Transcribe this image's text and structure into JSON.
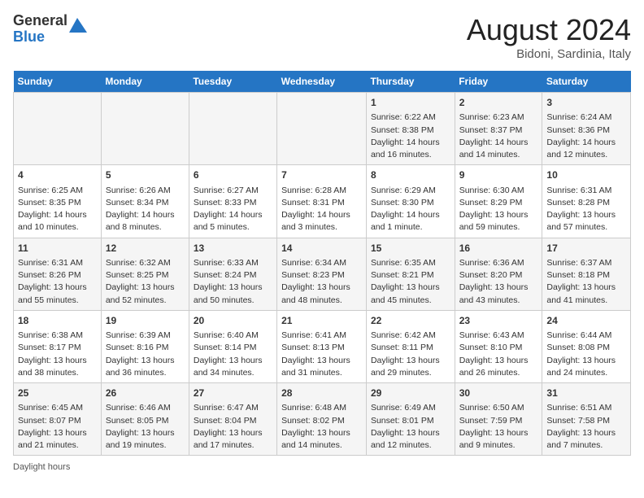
{
  "header": {
    "logo_general": "General",
    "logo_blue": "Blue",
    "month_year": "August 2024",
    "location": "Bidoni, Sardinia, Italy"
  },
  "days_of_week": [
    "Sunday",
    "Monday",
    "Tuesday",
    "Wednesday",
    "Thursday",
    "Friday",
    "Saturday"
  ],
  "weeks": [
    [
      {
        "day": "",
        "info": ""
      },
      {
        "day": "",
        "info": ""
      },
      {
        "day": "",
        "info": ""
      },
      {
        "day": "",
        "info": ""
      },
      {
        "day": "1",
        "info": "Sunrise: 6:22 AM\nSunset: 8:38 PM\nDaylight: 14 hours and 16 minutes."
      },
      {
        "day": "2",
        "info": "Sunrise: 6:23 AM\nSunset: 8:37 PM\nDaylight: 14 hours and 14 minutes."
      },
      {
        "day": "3",
        "info": "Sunrise: 6:24 AM\nSunset: 8:36 PM\nDaylight: 14 hours and 12 minutes."
      }
    ],
    [
      {
        "day": "4",
        "info": "Sunrise: 6:25 AM\nSunset: 8:35 PM\nDaylight: 14 hours and 10 minutes."
      },
      {
        "day": "5",
        "info": "Sunrise: 6:26 AM\nSunset: 8:34 PM\nDaylight: 14 hours and 8 minutes."
      },
      {
        "day": "6",
        "info": "Sunrise: 6:27 AM\nSunset: 8:33 PM\nDaylight: 14 hours and 5 minutes."
      },
      {
        "day": "7",
        "info": "Sunrise: 6:28 AM\nSunset: 8:31 PM\nDaylight: 14 hours and 3 minutes."
      },
      {
        "day": "8",
        "info": "Sunrise: 6:29 AM\nSunset: 8:30 PM\nDaylight: 14 hours and 1 minute."
      },
      {
        "day": "9",
        "info": "Sunrise: 6:30 AM\nSunset: 8:29 PM\nDaylight: 13 hours and 59 minutes."
      },
      {
        "day": "10",
        "info": "Sunrise: 6:31 AM\nSunset: 8:28 PM\nDaylight: 13 hours and 57 minutes."
      }
    ],
    [
      {
        "day": "11",
        "info": "Sunrise: 6:31 AM\nSunset: 8:26 PM\nDaylight: 13 hours and 55 minutes."
      },
      {
        "day": "12",
        "info": "Sunrise: 6:32 AM\nSunset: 8:25 PM\nDaylight: 13 hours and 52 minutes."
      },
      {
        "day": "13",
        "info": "Sunrise: 6:33 AM\nSunset: 8:24 PM\nDaylight: 13 hours and 50 minutes."
      },
      {
        "day": "14",
        "info": "Sunrise: 6:34 AM\nSunset: 8:23 PM\nDaylight: 13 hours and 48 minutes."
      },
      {
        "day": "15",
        "info": "Sunrise: 6:35 AM\nSunset: 8:21 PM\nDaylight: 13 hours and 45 minutes."
      },
      {
        "day": "16",
        "info": "Sunrise: 6:36 AM\nSunset: 8:20 PM\nDaylight: 13 hours and 43 minutes."
      },
      {
        "day": "17",
        "info": "Sunrise: 6:37 AM\nSunset: 8:18 PM\nDaylight: 13 hours and 41 minutes."
      }
    ],
    [
      {
        "day": "18",
        "info": "Sunrise: 6:38 AM\nSunset: 8:17 PM\nDaylight: 13 hours and 38 minutes."
      },
      {
        "day": "19",
        "info": "Sunrise: 6:39 AM\nSunset: 8:16 PM\nDaylight: 13 hours and 36 minutes."
      },
      {
        "day": "20",
        "info": "Sunrise: 6:40 AM\nSunset: 8:14 PM\nDaylight: 13 hours and 34 minutes."
      },
      {
        "day": "21",
        "info": "Sunrise: 6:41 AM\nSunset: 8:13 PM\nDaylight: 13 hours and 31 minutes."
      },
      {
        "day": "22",
        "info": "Sunrise: 6:42 AM\nSunset: 8:11 PM\nDaylight: 13 hours and 29 minutes."
      },
      {
        "day": "23",
        "info": "Sunrise: 6:43 AM\nSunset: 8:10 PM\nDaylight: 13 hours and 26 minutes."
      },
      {
        "day": "24",
        "info": "Sunrise: 6:44 AM\nSunset: 8:08 PM\nDaylight: 13 hours and 24 minutes."
      }
    ],
    [
      {
        "day": "25",
        "info": "Sunrise: 6:45 AM\nSunset: 8:07 PM\nDaylight: 13 hours and 21 minutes."
      },
      {
        "day": "26",
        "info": "Sunrise: 6:46 AM\nSunset: 8:05 PM\nDaylight: 13 hours and 19 minutes."
      },
      {
        "day": "27",
        "info": "Sunrise: 6:47 AM\nSunset: 8:04 PM\nDaylight: 13 hours and 17 minutes."
      },
      {
        "day": "28",
        "info": "Sunrise: 6:48 AM\nSunset: 8:02 PM\nDaylight: 13 hours and 14 minutes."
      },
      {
        "day": "29",
        "info": "Sunrise: 6:49 AM\nSunset: 8:01 PM\nDaylight: 13 hours and 12 minutes."
      },
      {
        "day": "30",
        "info": "Sunrise: 6:50 AM\nSunset: 7:59 PM\nDaylight: 13 hours and 9 minutes."
      },
      {
        "day": "31",
        "info": "Sunrise: 6:51 AM\nSunset: 7:58 PM\nDaylight: 13 hours and 7 minutes."
      }
    ]
  ],
  "footer": {
    "label": "Daylight hours"
  }
}
